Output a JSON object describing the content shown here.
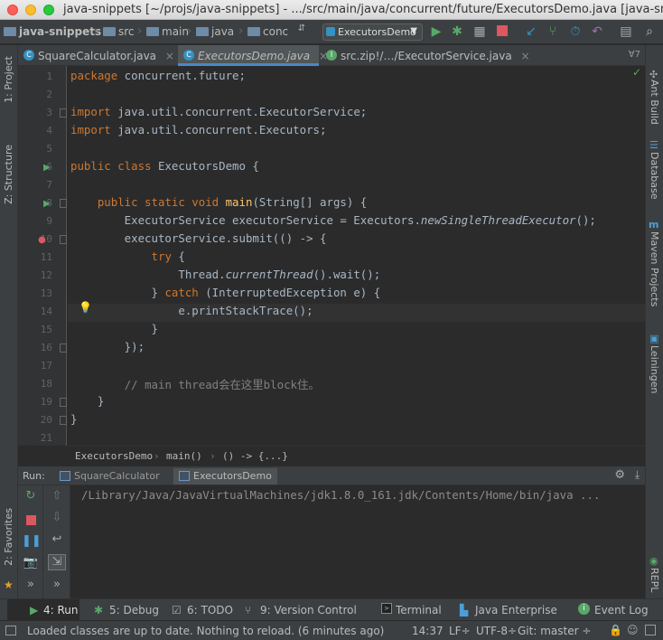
{
  "window": {
    "title": "java-snippets [~/projs/java-snippets] - .../src/main/java/concurrent/future/ExecutorsDemo.java [java-sni..."
  },
  "nav": {
    "project": "java-snippets",
    "crumbs": [
      "src",
      "main",
      "java",
      "conc"
    ],
    "run_config": "ExecutorsDemo"
  },
  "tabs": [
    {
      "label": "SquareCalculator.java",
      "active": false
    },
    {
      "label": "ExecutorsDemo.java",
      "active": true
    },
    {
      "label": "src.zip!/…/ExecutorService.java",
      "active": false
    }
  ],
  "tab_overflow": "∀7",
  "left_tools": {
    "project": "1: Project",
    "structure": "Z: Structure",
    "favorites": "2: Favorites"
  },
  "right_tools": {
    "ant": "Ant Build",
    "database": "Database",
    "maven": "Maven Projects",
    "leiningen": "Leiningen",
    "repl": "REPL"
  },
  "code_lines": [
    {
      "n": "1",
      "t": "package concurrent.future;"
    },
    {
      "n": "2",
      "t": ""
    },
    {
      "n": "3",
      "t": "import java.util.concurrent.ExecutorService;"
    },
    {
      "n": "4",
      "t": "import java.util.concurrent.Executors;"
    },
    {
      "n": "5",
      "t": ""
    },
    {
      "n": "6",
      "t": "public class ExecutorsDemo {"
    },
    {
      "n": "7",
      "t": ""
    },
    {
      "n": "8",
      "t": "    public static void main(String[] args) {"
    },
    {
      "n": "9",
      "t": "        ExecutorService executorService = Executors.newSingleThreadExecutor();"
    },
    {
      "n": "10",
      "t": "        executorService.submit(() -> {"
    },
    {
      "n": "11",
      "t": "            try {"
    },
    {
      "n": "12",
      "t": "                Thread.currentThread().wait();"
    },
    {
      "n": "13",
      "t": "            } catch (InterruptedException e) {"
    },
    {
      "n": "14",
      "t": "                e.printStackTrace();"
    },
    {
      "n": "15",
      "t": "            }"
    },
    {
      "n": "16",
      "t": "        });"
    },
    {
      "n": "17",
      "t": ""
    },
    {
      "n": "18",
      "t": "        // main thread会在这里block住。"
    },
    {
      "n": "19",
      "t": "    }"
    },
    {
      "n": "20",
      "t": "}"
    },
    {
      "n": "21",
      "t": ""
    }
  ],
  "breadcrumb": [
    "ExecutorsDemo",
    "main()",
    "() -> {...}"
  ],
  "run": {
    "label": "Run:",
    "tabs": [
      "SquareCalculator",
      "ExecutorsDemo"
    ],
    "output": "/Library/Java/JavaVirtualMachines/jdk1.8.0_161.jdk/Contents/Home/bin/java ..."
  },
  "toolwindows": [
    {
      "label": "4: Run"
    },
    {
      "label": "5: Debug"
    },
    {
      "label": "6: TODO"
    },
    {
      "label": "9: Version Control"
    },
    {
      "label": "Terminal"
    },
    {
      "label": "Java Enterprise"
    },
    {
      "label": "Event Log"
    }
  ],
  "status": {
    "message": "Loaded classes are up to date. Nothing to reload. (6 minutes ago)",
    "position": "14:37",
    "line_sep": "LF÷",
    "encoding": "UTF-8÷",
    "git": "Git: master ÷"
  }
}
